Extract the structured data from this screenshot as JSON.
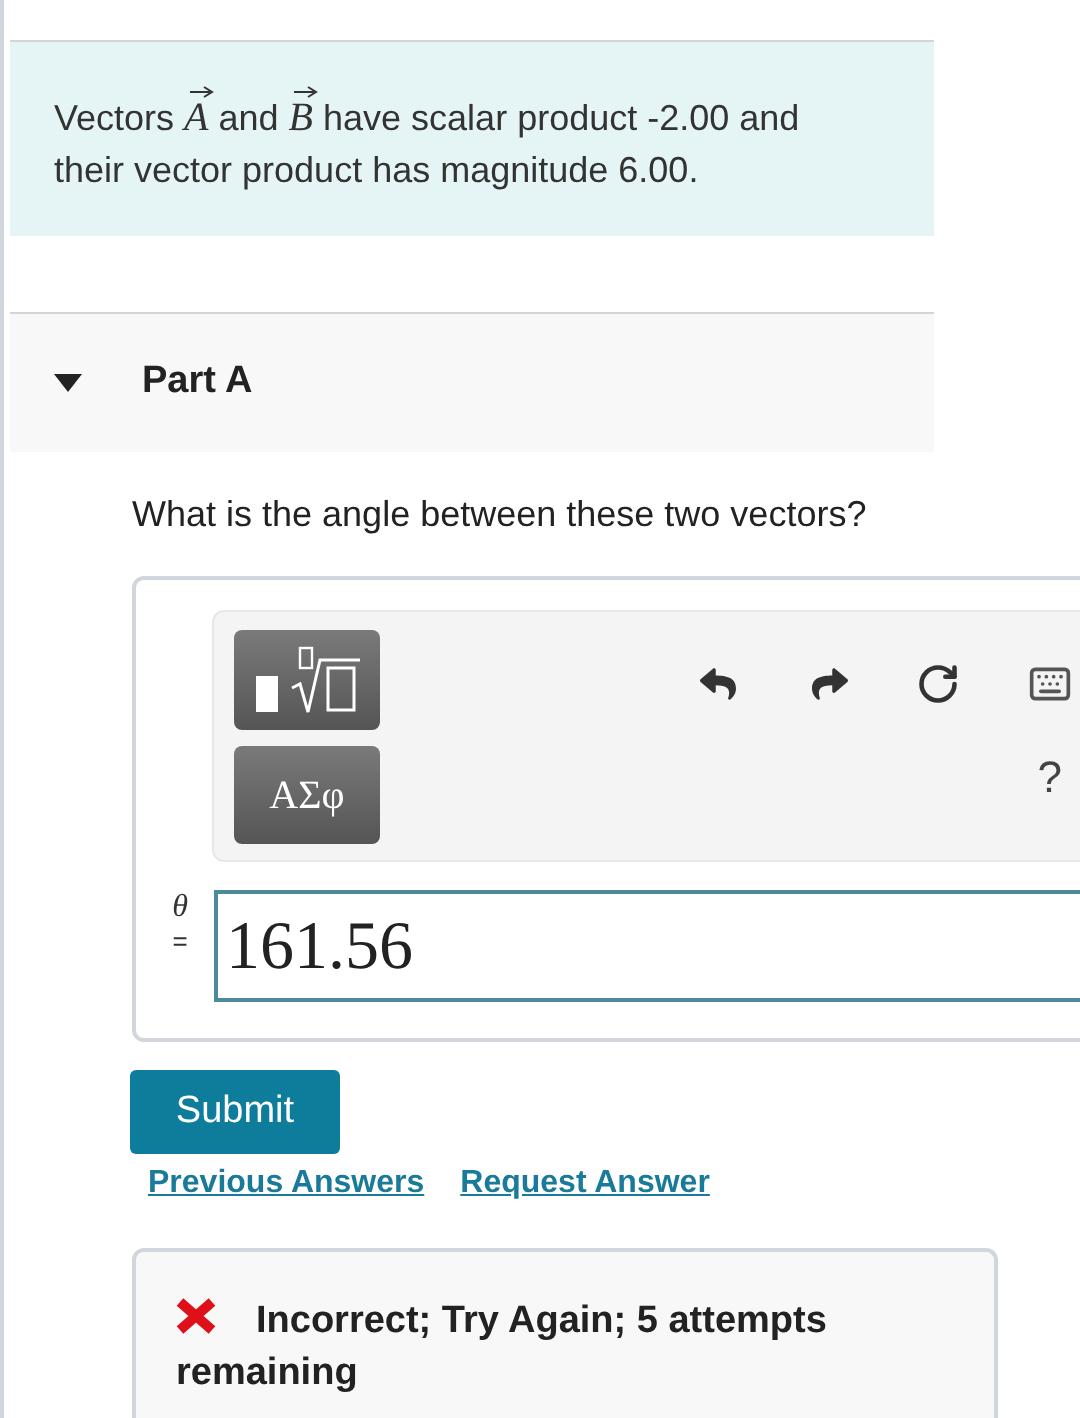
{
  "problem": {
    "segments": [
      {
        "kind": "text",
        "text": "Vectors "
      },
      {
        "kind": "vector",
        "text": "A"
      },
      {
        "kind": "text",
        "text": " and "
      },
      {
        "kind": "vector",
        "text": "B"
      },
      {
        "kind": "text",
        "text": " have scalar product -2.00 and their vector product has magnitude 6.00."
      }
    ]
  },
  "part": {
    "title": "Part A",
    "expanded": true
  },
  "question": "What is the angle between these two vectors?",
  "toolbar": {
    "greek_button": "ΑΣφ",
    "help": "?"
  },
  "answer": {
    "variable": "θ",
    "equals": "=",
    "value": "161.56"
  },
  "submit": "Submit",
  "links": [
    "Previous Answers",
    "Request Answer"
  ],
  "feedback": {
    "correct": false,
    "message": "Incorrect; Try Again; 5 attempts remaining"
  }
}
